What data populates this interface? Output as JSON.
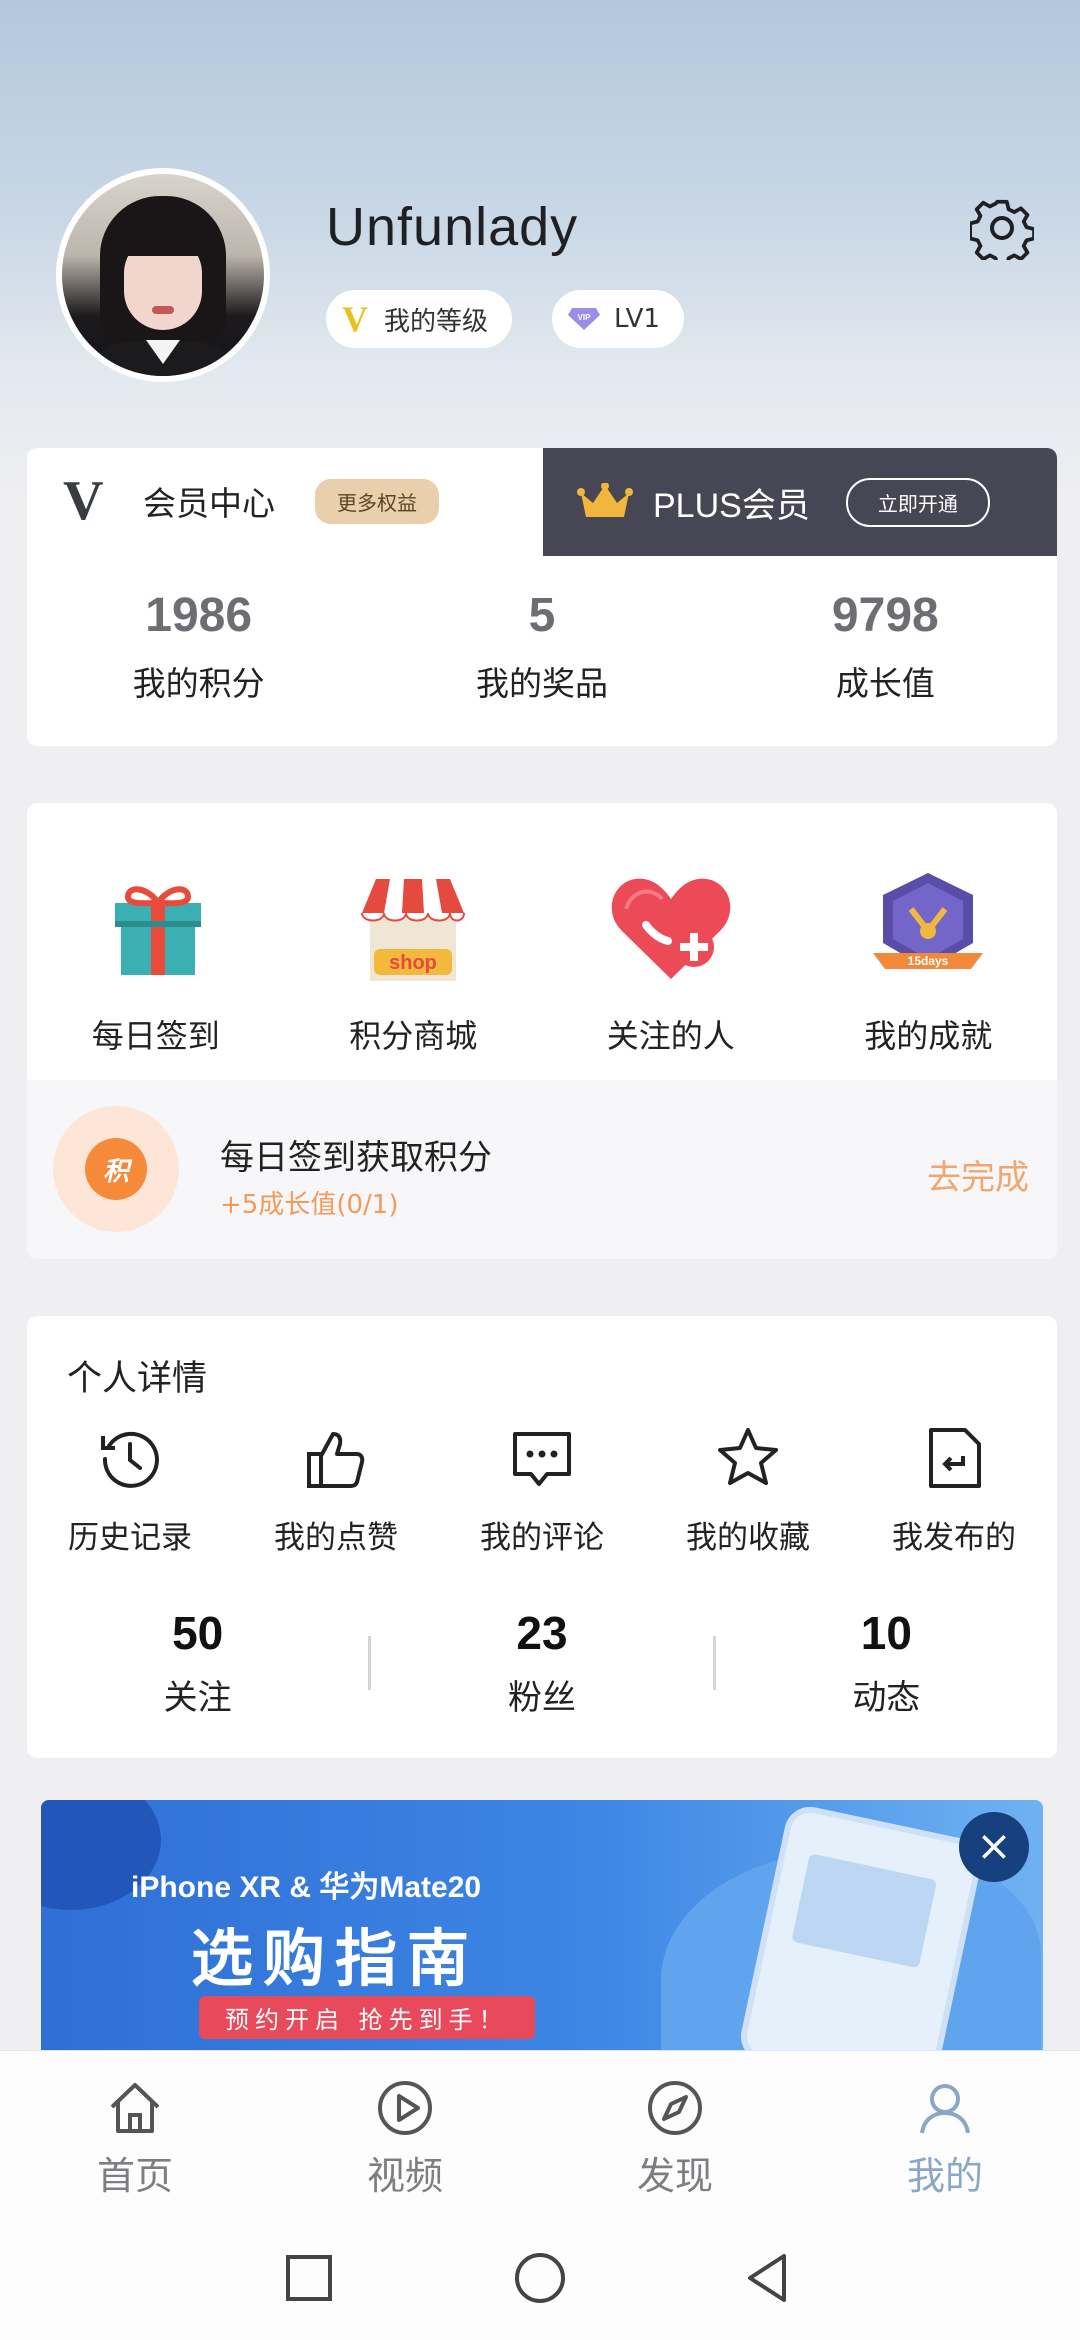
{
  "profile": {
    "username": "Unfunlady",
    "level_pill": "我的等级",
    "lv_pill": "LV1"
  },
  "member": {
    "title": "会员中心",
    "badge": "更多权益",
    "plus_label": "PLUS会员",
    "plus_button": "立即开通",
    "stats": [
      {
        "value": "1986",
        "label": "我的积分"
      },
      {
        "value": "5",
        "label": "我的奖品"
      },
      {
        "value": "9798",
        "label": "成长值"
      }
    ]
  },
  "features": [
    {
      "label": "每日签到",
      "icon": "gift-icon"
    },
    {
      "label": "积分商城",
      "icon": "shop-icon"
    },
    {
      "label": "关注的人",
      "icon": "heart-plus-icon"
    },
    {
      "label": "我的成就",
      "icon": "achievement-badge-icon"
    }
  ],
  "task": {
    "icon_text": "积",
    "title": "每日签到获取积分",
    "subtitle": "+5成长值(0/1)",
    "action": "去完成"
  },
  "personal": {
    "title": "个人详情",
    "items": [
      {
        "label": "历史记录",
        "icon": "history-icon"
      },
      {
        "label": "我的点赞",
        "icon": "thumbs-up-icon"
      },
      {
        "label": "我的评论",
        "icon": "comment-icon"
      },
      {
        "label": "我的收藏",
        "icon": "star-icon"
      },
      {
        "label": "我发布的",
        "icon": "published-icon"
      }
    ],
    "follow": [
      {
        "value": "50",
        "label": "关注"
      },
      {
        "value": "23",
        "label": "粉丝"
      },
      {
        "value": "10",
        "label": "动态"
      }
    ]
  },
  "banner": {
    "line1": "iPhone XR & 华为Mate20",
    "line2": "选购指南",
    "line3": "预约开启 抢先到手！",
    "close": "×"
  },
  "nav": [
    {
      "label": "首页",
      "icon": "home-icon",
      "active": false
    },
    {
      "label": "视频",
      "icon": "play-icon",
      "active": false
    },
    {
      "label": "发现",
      "icon": "compass-icon",
      "active": false
    },
    {
      "label": "我的",
      "icon": "user-icon",
      "active": true
    }
  ],
  "colors": {
    "accent": "#8aa7c8",
    "plus_bg": "#464655",
    "task_action": "#f2a56d",
    "badge_bg": "#e9cfab"
  }
}
